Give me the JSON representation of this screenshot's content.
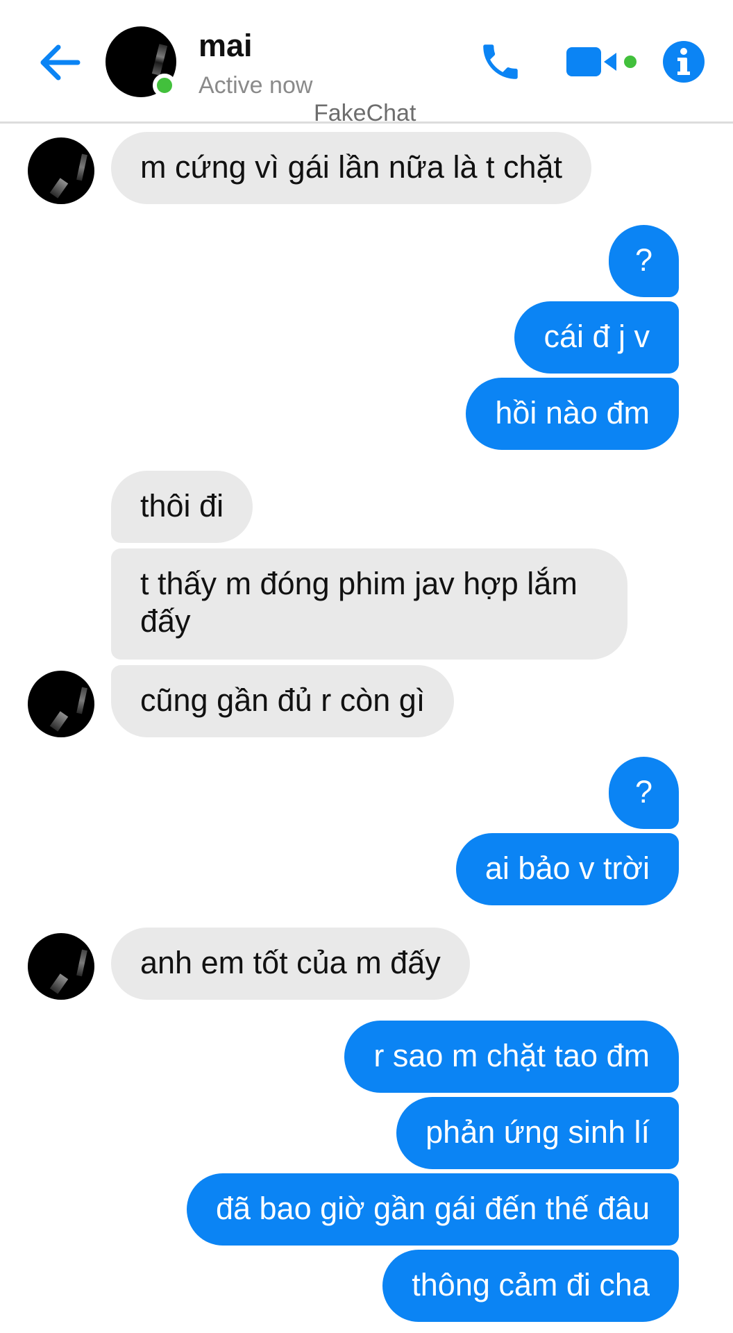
{
  "header": {
    "contact_name": "mai",
    "status": "Active now",
    "watermark": "FakeChat",
    "icons": [
      "back-arrow-icon",
      "phone-icon",
      "video-camera-icon",
      "info-icon"
    ],
    "accent_color": "#0b84f4",
    "online_color": "#42c03c"
  },
  "messages": [
    {
      "from": "them",
      "text": "m cứng vì gái lần nữa là t chặt"
    },
    {
      "from": "me",
      "text": "?"
    },
    {
      "from": "me",
      "text": "cái đ j v"
    },
    {
      "from": "me",
      "text": "hồi nào đm"
    },
    {
      "from": "them",
      "text": "thôi đi"
    },
    {
      "from": "them",
      "text": "t thấy m đóng phim jav hợp lắm đấy"
    },
    {
      "from": "them",
      "text": "cũng gần đủ r còn gì"
    },
    {
      "from": "me",
      "text": "?"
    },
    {
      "from": "me",
      "text": "ai bảo v trời"
    },
    {
      "from": "them",
      "text": "anh em tốt của m đấy"
    },
    {
      "from": "me",
      "text": "r sao m chặt tao đm"
    },
    {
      "from": "me",
      "text": "phản ứng sinh lí"
    },
    {
      "from": "me",
      "text": "đã bao giờ gần gái đến thế đâu"
    },
    {
      "from": "me",
      "text": "thông cảm đi cha"
    }
  ]
}
